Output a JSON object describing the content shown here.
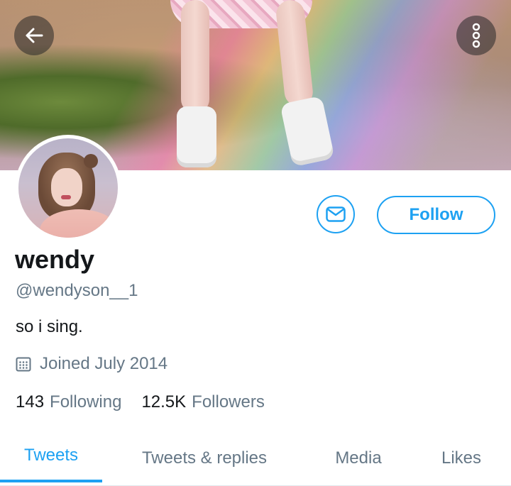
{
  "header": {
    "back_icon": "arrow-left-icon",
    "more_icon": "more-vertical-icon"
  },
  "profile": {
    "display_name": "wendy",
    "handle": "@wendyson__1",
    "bio": "so i sing.",
    "joined": "Joined July 2014",
    "calendar_icon": "calendar-icon"
  },
  "actions": {
    "message_icon": "envelope-icon",
    "follow_label": "Follow"
  },
  "stats": {
    "following_count": "143",
    "following_label": "Following",
    "followers_count": "12.5K",
    "followers_label": "Followers"
  },
  "tabs": [
    {
      "label": "Tweets",
      "active": true
    },
    {
      "label": "Tweets & replies",
      "active": false
    },
    {
      "label": "Media",
      "active": false
    },
    {
      "label": "Likes",
      "active": false
    }
  ],
  "colors": {
    "accent": "#1da1f2",
    "secondary_text": "#657786",
    "primary_text": "#14171a"
  }
}
